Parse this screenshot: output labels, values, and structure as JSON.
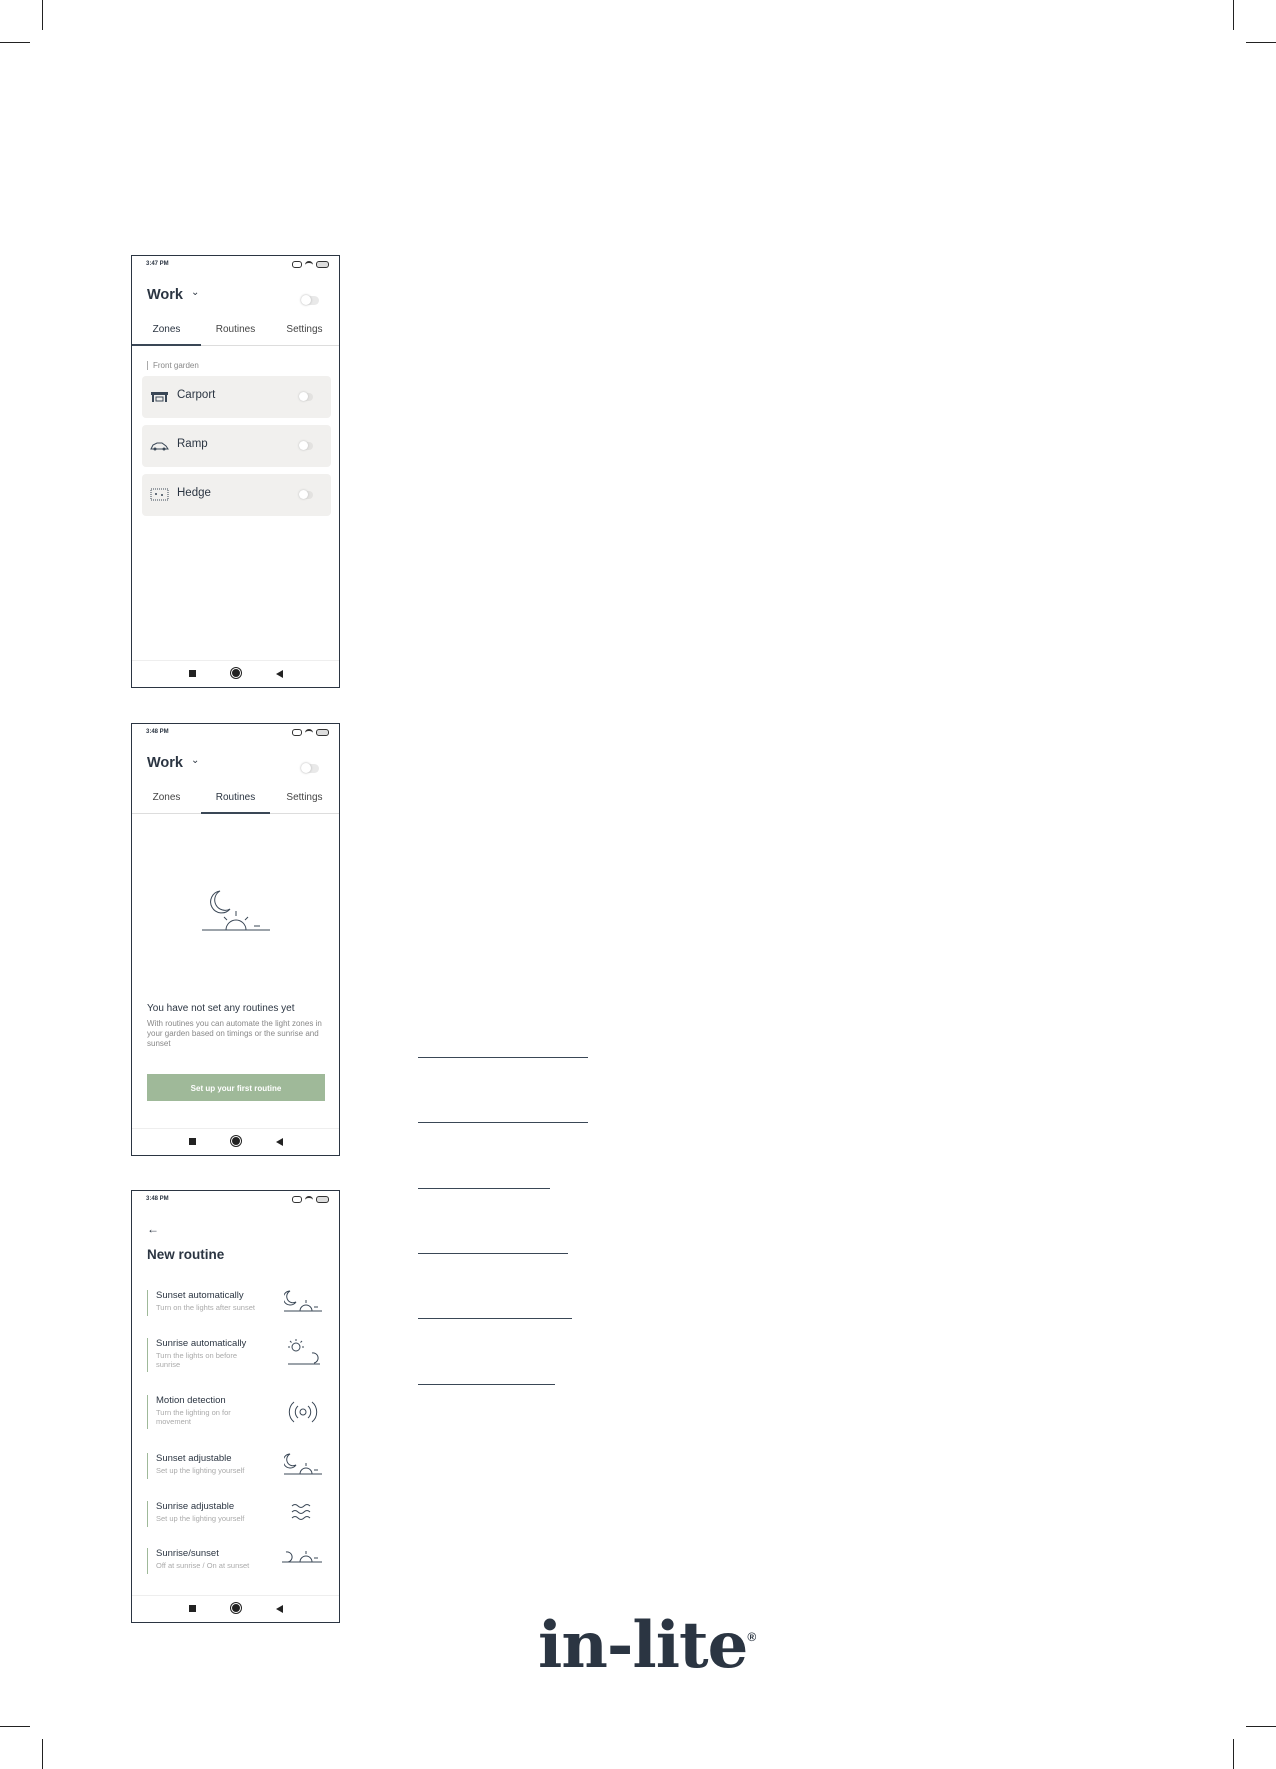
{
  "screen1": {
    "time": "3:47 PM",
    "title": "Work",
    "tabs": [
      "Zones",
      "Routines",
      "Settings"
    ],
    "section_label": "Front garden",
    "zones": [
      {
        "label": "Carport",
        "icon": "carport-icon"
      },
      {
        "label": "Ramp",
        "icon": "car-icon"
      },
      {
        "label": "Hedge",
        "icon": "hedge-icon"
      }
    ]
  },
  "screen2": {
    "time": "3:48 PM",
    "title": "Work",
    "tabs": [
      "Zones",
      "Routines",
      "Settings"
    ],
    "empty_heading": "You have not set any routines yet",
    "empty_text": "With routines you can automate the light zones in your garden based on timings or the sunrise and sunset",
    "cta_label": "Set up your first routine"
  },
  "screen3": {
    "time": "3:48 PM",
    "title": "New routine",
    "routines": [
      {
        "title": "Sunset automatically",
        "subtitle": "Turn on the lights after sunset",
        "icon": "sunset-icon"
      },
      {
        "title": "Sunrise automatically",
        "subtitle": "Turn the lights on before sunrise",
        "icon": "sunrise-icon"
      },
      {
        "title": "Motion detection",
        "subtitle": "Turn the lighting on for movement",
        "icon": "motion-icon"
      },
      {
        "title": "Sunset adjustable",
        "subtitle": "Set up the lighting yourself",
        "icon": "sunset-adjustable-icon"
      },
      {
        "title": "Sunrise adjustable",
        "subtitle": "Set up the lighting yourself",
        "icon": "waves-icon"
      },
      {
        "title": "Sunrise/sunset",
        "subtitle": "Off at sunrise / On at sunset",
        "icon": "sunrise-sunset-icon"
      }
    ]
  },
  "brand": {
    "name": "in-lite",
    "mark": "®"
  },
  "colors": {
    "ink": "#2b3542",
    "accent": "#9fb999",
    "card": "#f1f0ee"
  }
}
